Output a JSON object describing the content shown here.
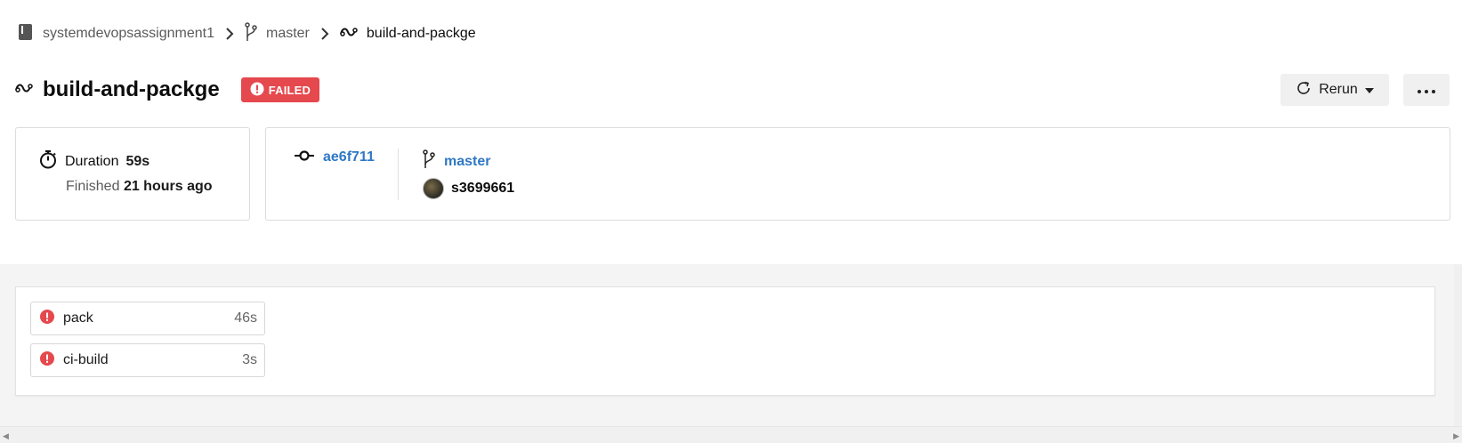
{
  "breadcrumb": {
    "repo": "systemdevopsassignment1",
    "branch": "master",
    "pipeline": "build-and-packge"
  },
  "header": {
    "title": "build-and-packge",
    "status": "FAILED",
    "rerun_label": "Rerun"
  },
  "summary": {
    "duration_label": "Duration",
    "duration_value": "59s",
    "finished_label": "Finished",
    "finished_value": "21 hours ago",
    "commit": "ae6f711",
    "branch": "master",
    "user": "s3699661"
  },
  "stages": [
    {
      "name": "pack",
      "duration": "46s",
      "status": "failed"
    },
    {
      "name": "ci-build",
      "duration": "3s",
      "status": "failed"
    }
  ],
  "colors": {
    "failed": "#e5484d",
    "link": "#2f78c4"
  },
  "icons": [
    "repo-icon",
    "chevron-right-icon",
    "branch-icon",
    "pipeline-icon",
    "alert-icon",
    "refresh-icon",
    "caret-down-icon",
    "more-icon",
    "stopwatch-icon",
    "commit-icon"
  ]
}
